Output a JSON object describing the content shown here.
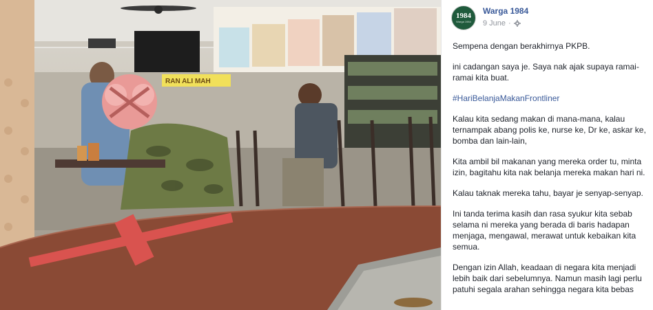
{
  "page": {
    "name": "Warga 1984",
    "date": "9 June",
    "separator": "·",
    "avatar_text": "1984",
    "avatar_subtext": "Warga 1984"
  },
  "post": {
    "paragraphs": [
      "Sempena dengan berakhirnya PKPB.",
      "ini cadangan saya je. Saya nak ajak supaya ramai-ramai kita buat.",
      "#HariBelanjaMakanFrontliner",
      "Kalau kita sedang makan di mana-mana, kalau ternampak abang polis ke, nurse ke, Dr ke, askar ke, bomba dan lain-lain,",
      "Kita ambil bil makanan yang mereka order tu, minta izin, bagitahu kita nak belanja mereka makan hari ni.",
      "Kalau taknak mereka tahu, bayar je senyap-senyap.",
      "Ini tanda terima kasih dan rasa syukur kita sebab selama ni mereka yang berada di baris hadapan menjaga, mengawal, merawat untuk kebaikan kita semua.",
      "Dengan izin Allah, keadaan di negara kita menjadi lebih baik dari sebelumnya. Namun masih lagi perlu patuhi segala arahan sehingga negara kita bebas"
    ]
  },
  "photo": {
    "shop_sign": "RAN  ALI MAH"
  },
  "colors": {
    "link": "#385898",
    "text": "#1d2129",
    "meta": "#90949c",
    "tape": "#d9534f",
    "table": "#8a4a35"
  },
  "icons": {
    "privacy": "gear-icon"
  }
}
